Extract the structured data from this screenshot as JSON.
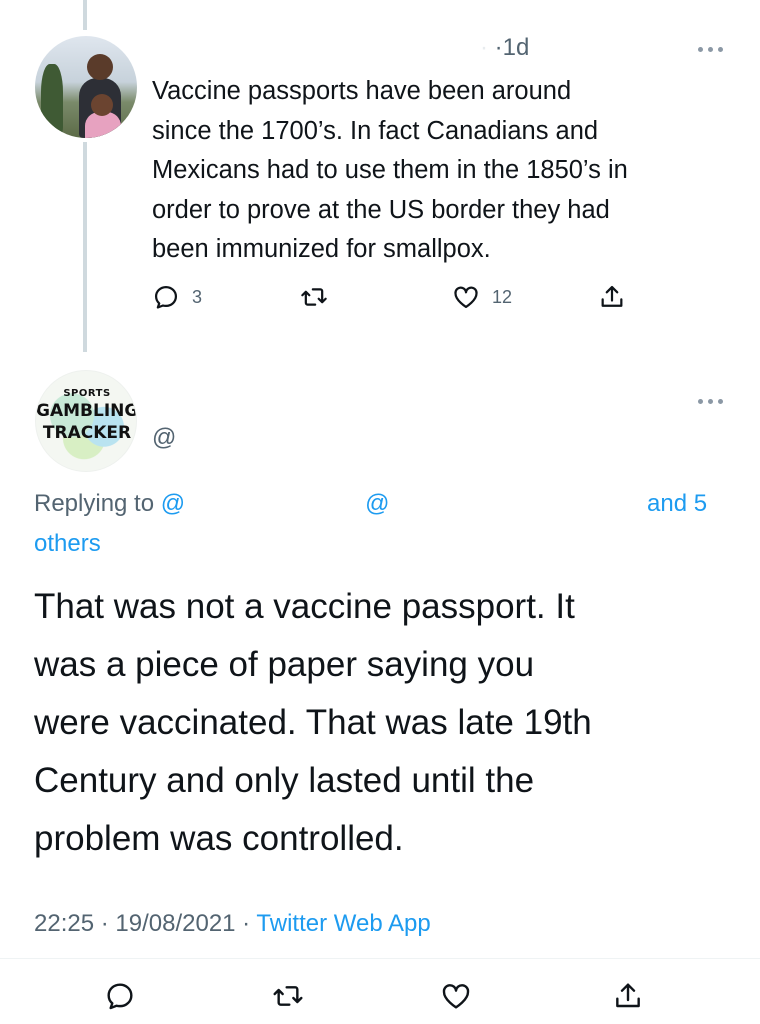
{
  "colors": {
    "text_primary": "#0f1419",
    "text_secondary": "#536471",
    "link": "#1d9bf0",
    "thread_line": "#cfd9de"
  },
  "tweet1": {
    "time": "1d",
    "text": "Vaccine passports have been around\nsince the 1700’s. In fact Canadians and\nMexicans had to use them in the 1850’s in\norder to prove at the US border they had\nbeen immunized for smallpox.",
    "actions": {
      "reply_icon": "reply-icon",
      "reply_count": "3",
      "retweet_icon": "retweet-icon",
      "like_icon": "heart-icon",
      "like_count": "12",
      "share_icon": "share-icon"
    }
  },
  "tweet2": {
    "avatar_logo": {
      "line1": "SPORTS",
      "line2": "GAMBLING",
      "line3": "TRACKER"
    },
    "handle": "@",
    "replying": {
      "prefix": "Replying to ",
      "mention1": "@",
      "mention2": "@",
      "and_text": "and 5",
      "others_text": "others"
    },
    "text": "That was not a vaccine passport.  It\nwas a piece of paper saying you\nwere vaccinated.  That was late 19th\nCentury and only lasted until the\nproblem was controlled.",
    "timestamp": {
      "time": "22:25",
      "date": "19/08/2021",
      "source": "Twitter Web App"
    }
  }
}
